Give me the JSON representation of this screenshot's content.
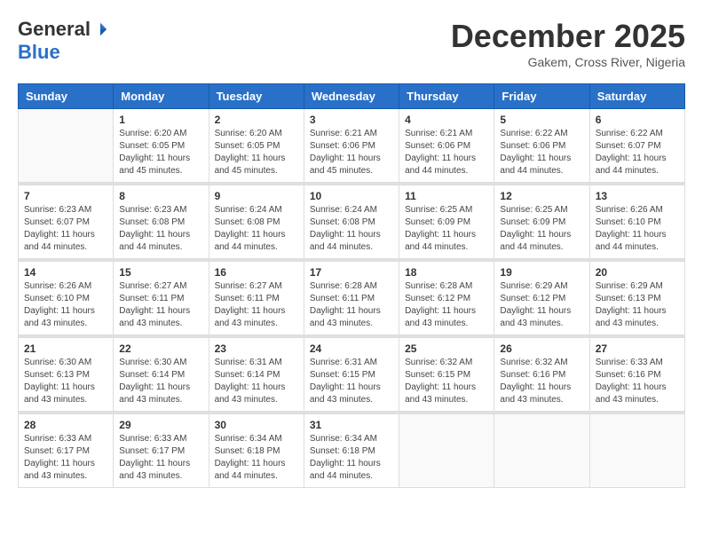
{
  "header": {
    "logo_general": "General",
    "logo_blue": "Blue",
    "month_title": "December 2025",
    "subtitle": "Gakem, Cross River, Nigeria"
  },
  "days_of_week": [
    "Sunday",
    "Monday",
    "Tuesday",
    "Wednesday",
    "Thursday",
    "Friday",
    "Saturday"
  ],
  "weeks": [
    [
      {
        "day": "",
        "info": ""
      },
      {
        "day": "1",
        "info": "Sunrise: 6:20 AM\nSunset: 6:05 PM\nDaylight: 11 hours and 45 minutes."
      },
      {
        "day": "2",
        "info": "Sunrise: 6:20 AM\nSunset: 6:05 PM\nDaylight: 11 hours and 45 minutes."
      },
      {
        "day": "3",
        "info": "Sunrise: 6:21 AM\nSunset: 6:06 PM\nDaylight: 11 hours and 45 minutes."
      },
      {
        "day": "4",
        "info": "Sunrise: 6:21 AM\nSunset: 6:06 PM\nDaylight: 11 hours and 44 minutes."
      },
      {
        "day": "5",
        "info": "Sunrise: 6:22 AM\nSunset: 6:06 PM\nDaylight: 11 hours and 44 minutes."
      },
      {
        "day": "6",
        "info": "Sunrise: 6:22 AM\nSunset: 6:07 PM\nDaylight: 11 hours and 44 minutes."
      }
    ],
    [
      {
        "day": "7",
        "info": "Sunrise: 6:23 AM\nSunset: 6:07 PM\nDaylight: 11 hours and 44 minutes."
      },
      {
        "day": "8",
        "info": "Sunrise: 6:23 AM\nSunset: 6:08 PM\nDaylight: 11 hours and 44 minutes."
      },
      {
        "day": "9",
        "info": "Sunrise: 6:24 AM\nSunset: 6:08 PM\nDaylight: 11 hours and 44 minutes."
      },
      {
        "day": "10",
        "info": "Sunrise: 6:24 AM\nSunset: 6:08 PM\nDaylight: 11 hours and 44 minutes."
      },
      {
        "day": "11",
        "info": "Sunrise: 6:25 AM\nSunset: 6:09 PM\nDaylight: 11 hours and 44 minutes."
      },
      {
        "day": "12",
        "info": "Sunrise: 6:25 AM\nSunset: 6:09 PM\nDaylight: 11 hours and 44 minutes."
      },
      {
        "day": "13",
        "info": "Sunrise: 6:26 AM\nSunset: 6:10 PM\nDaylight: 11 hours and 44 minutes."
      }
    ],
    [
      {
        "day": "14",
        "info": "Sunrise: 6:26 AM\nSunset: 6:10 PM\nDaylight: 11 hours and 43 minutes."
      },
      {
        "day": "15",
        "info": "Sunrise: 6:27 AM\nSunset: 6:11 PM\nDaylight: 11 hours and 43 minutes."
      },
      {
        "day": "16",
        "info": "Sunrise: 6:27 AM\nSunset: 6:11 PM\nDaylight: 11 hours and 43 minutes."
      },
      {
        "day": "17",
        "info": "Sunrise: 6:28 AM\nSunset: 6:11 PM\nDaylight: 11 hours and 43 minutes."
      },
      {
        "day": "18",
        "info": "Sunrise: 6:28 AM\nSunset: 6:12 PM\nDaylight: 11 hours and 43 minutes."
      },
      {
        "day": "19",
        "info": "Sunrise: 6:29 AM\nSunset: 6:12 PM\nDaylight: 11 hours and 43 minutes."
      },
      {
        "day": "20",
        "info": "Sunrise: 6:29 AM\nSunset: 6:13 PM\nDaylight: 11 hours and 43 minutes."
      }
    ],
    [
      {
        "day": "21",
        "info": "Sunrise: 6:30 AM\nSunset: 6:13 PM\nDaylight: 11 hours and 43 minutes."
      },
      {
        "day": "22",
        "info": "Sunrise: 6:30 AM\nSunset: 6:14 PM\nDaylight: 11 hours and 43 minutes."
      },
      {
        "day": "23",
        "info": "Sunrise: 6:31 AM\nSunset: 6:14 PM\nDaylight: 11 hours and 43 minutes."
      },
      {
        "day": "24",
        "info": "Sunrise: 6:31 AM\nSunset: 6:15 PM\nDaylight: 11 hours and 43 minutes."
      },
      {
        "day": "25",
        "info": "Sunrise: 6:32 AM\nSunset: 6:15 PM\nDaylight: 11 hours and 43 minutes."
      },
      {
        "day": "26",
        "info": "Sunrise: 6:32 AM\nSunset: 6:16 PM\nDaylight: 11 hours and 43 minutes."
      },
      {
        "day": "27",
        "info": "Sunrise: 6:33 AM\nSunset: 6:16 PM\nDaylight: 11 hours and 43 minutes."
      }
    ],
    [
      {
        "day": "28",
        "info": "Sunrise: 6:33 AM\nSunset: 6:17 PM\nDaylight: 11 hours and 43 minutes."
      },
      {
        "day": "29",
        "info": "Sunrise: 6:33 AM\nSunset: 6:17 PM\nDaylight: 11 hours and 43 minutes."
      },
      {
        "day": "30",
        "info": "Sunrise: 6:34 AM\nSunset: 6:18 PM\nDaylight: 11 hours and 44 minutes."
      },
      {
        "day": "31",
        "info": "Sunrise: 6:34 AM\nSunset: 6:18 PM\nDaylight: 11 hours and 44 minutes."
      },
      {
        "day": "",
        "info": ""
      },
      {
        "day": "",
        "info": ""
      },
      {
        "day": "",
        "info": ""
      }
    ]
  ]
}
